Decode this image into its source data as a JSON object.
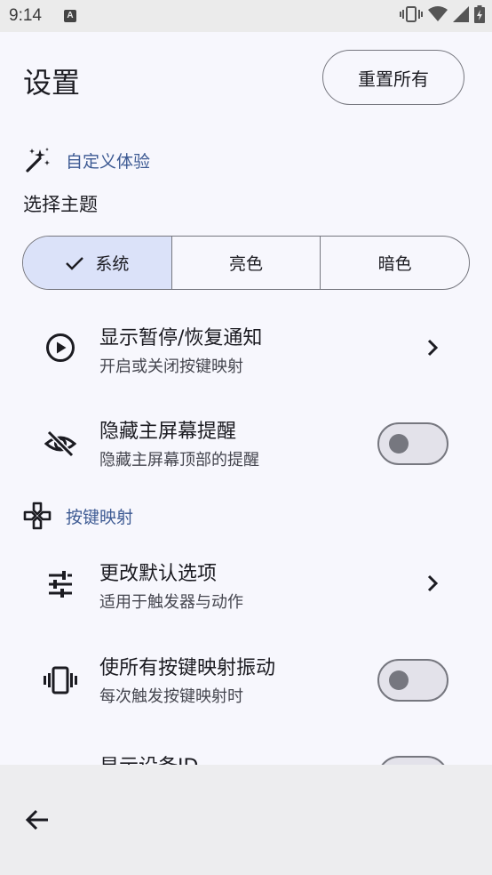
{
  "status_bar": {
    "time": "9:14",
    "notification_icon": "A",
    "icons": [
      "vibrate-icon",
      "wifi-icon",
      "signal-icon",
      "battery-charging-icon"
    ]
  },
  "header": {
    "title": "设置",
    "reset_label": "重置所有"
  },
  "sections": {
    "customize": {
      "label": "自定义体验",
      "icon": "magic-wand-icon"
    },
    "keymaps": {
      "label": "按键映射",
      "icon": "gamepad-icon"
    }
  },
  "theme": {
    "label": "选择主题",
    "options": [
      "系统",
      "亮色",
      "暗色"
    ],
    "selected": "系统"
  },
  "settings": {
    "pause_notification": {
      "title": "显示暂停/恢复通知",
      "subtitle": "开启或关闭按键映射",
      "icon": "play-circle-icon"
    },
    "hide_home_reminder": {
      "title": "隐藏主屏幕提醒",
      "subtitle": "隐藏主屏幕顶部的提醒",
      "icon": "visibility-off-icon",
      "enabled": false
    },
    "change_defaults": {
      "title": "更改默认选项",
      "subtitle": "适用于触发器与动作",
      "icon": "tune-icon"
    },
    "vibrate_all": {
      "title": "使所有按键映射振动",
      "subtitle": "每次触发按键映射时",
      "icon": "vibration-icon",
      "enabled": false
    },
    "show_device_id": {
      "title": "显示设备ID"
    }
  },
  "colors": {
    "accent": "#3d5a93",
    "selected_segment": "#dbe2f9",
    "background": "#f7f7fd",
    "outline": "#76777f"
  }
}
